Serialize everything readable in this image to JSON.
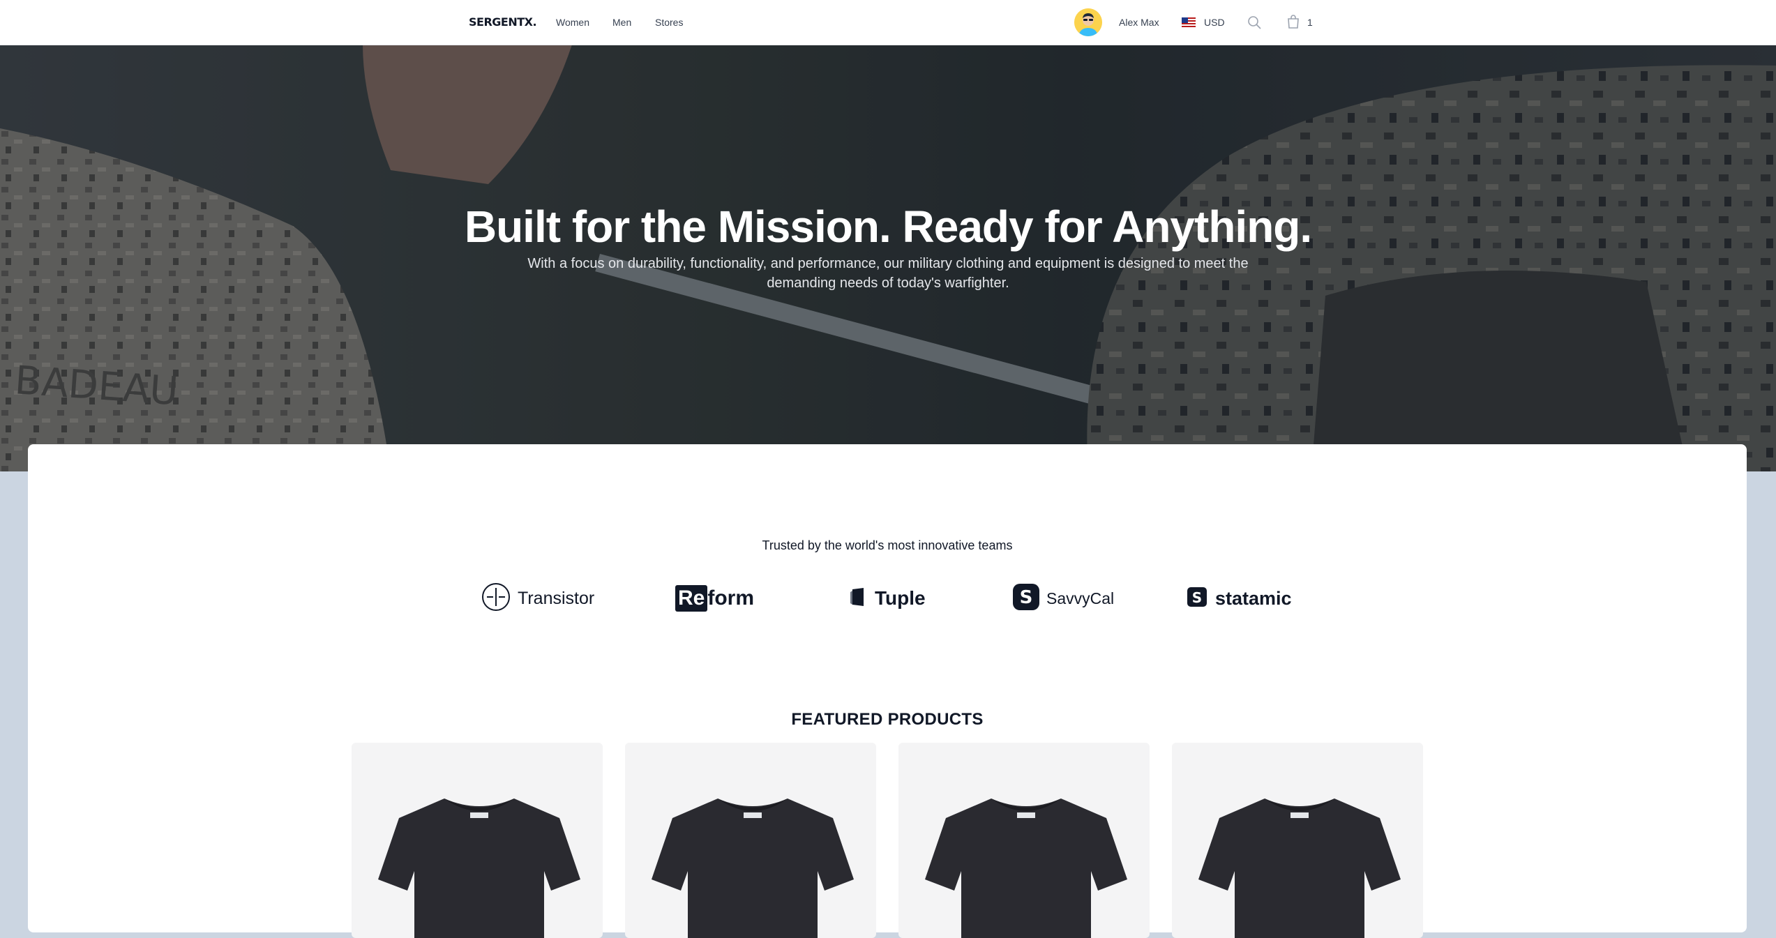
{
  "nav": {
    "logo": "SERGENTX.",
    "links": [
      "Women",
      "Men",
      "Stores"
    ],
    "user_name": "Alex Max",
    "currency": "USD",
    "cart_count": "1"
  },
  "hero": {
    "title": "Built for the Mission. Ready for Anything.",
    "subtitle": "With a focus on durability, functionality, and performance, our military clothing and equipment is designed to meet the demanding needs of today's warfighter.",
    "image_text": "BADEAU"
  },
  "trusted": {
    "heading": "Trusted by the world's most innovative teams",
    "brands": [
      {
        "name": "Transistor",
        "icon": "transistor-logo-icon"
      },
      {
        "name": "Reform",
        "icon": "reform-logo-icon"
      },
      {
        "name": "Tuple",
        "icon": "tuple-logo-icon"
      },
      {
        "name": "SavvyCal",
        "icon": "savvycal-logo-icon"
      },
      {
        "name": "statamic",
        "icon": "statamic-logo-icon"
      }
    ]
  },
  "featured": {
    "heading": "FEATURED PRODUCTS"
  },
  "colors": {
    "page_bg": "#cbd5e1",
    "text": "#111827",
    "product_bg": "#f4f4f5",
    "shirt": "#2a2a30"
  }
}
